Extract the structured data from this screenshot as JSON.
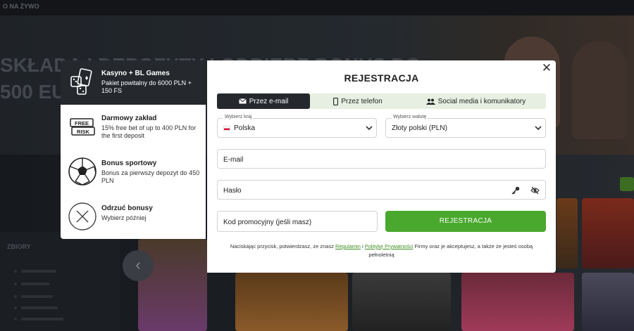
{
  "background": {
    "top_label": "O NA ŻYWO",
    "hero_line1": "SKŁADA I DEPOZYTY I ODBIERZ BONUS DO",
    "hero_line2": "500 EU",
    "sidebar_title": "ZBIORY"
  },
  "bonus_options": [
    {
      "title": "Kasyno + BL Games",
      "desc": "Pakiet powitalny do 6000 PLN + 150 FS",
      "icon": "casino-dice-cards-icon",
      "active": true
    },
    {
      "title": "Darmowy zakład",
      "desc": "15% free bet of up to 400 PLN for the first deposit",
      "icon": "free-risk-ticket-icon",
      "active": false,
      "icon_text_1": "FREE",
      "icon_text_2": "RISK"
    },
    {
      "title": "Bonus sportowy",
      "desc": "Bonus za pierwszy depozyt do 450 PLN",
      "icon": "soccer-ball-icon",
      "active": false
    },
    {
      "title": "Odrzuć bonusy",
      "desc": "Wybierz później",
      "icon": "close-circle-icon",
      "active": false
    }
  ],
  "modal": {
    "title": "REJESTRACJA",
    "close_icon": "close-icon",
    "tabs": [
      {
        "label": "Przez e-mail",
        "icon": "envelope-icon",
        "active": true
      },
      {
        "label": "Przez telefon",
        "icon": "phone-icon",
        "active": false
      },
      {
        "label": "Social media i komunikatory",
        "icon": "users-icon",
        "active": false
      }
    ],
    "country": {
      "label": "Wybierz kraj",
      "value": "Polska"
    },
    "currency": {
      "label": "Wybierz walutę",
      "value": "Złoty polski (PLN)"
    },
    "email_placeholder": "E-mail",
    "password_placeholder": "Hasło",
    "promo_placeholder": "Kod promocyjny (jeśli masz)",
    "register_label": "REJESTRACJA",
    "terms": {
      "before": "Naciskając przycisk, potwierdzasz, że znasz ",
      "link1": "Regulamin",
      "middle": " i ",
      "link2": "Politykę Prywatności",
      "after": " Firmy oraz je akceptujesz, a także że jesteś osobą pełnoletnią"
    },
    "accent_color": "#49a82d"
  }
}
